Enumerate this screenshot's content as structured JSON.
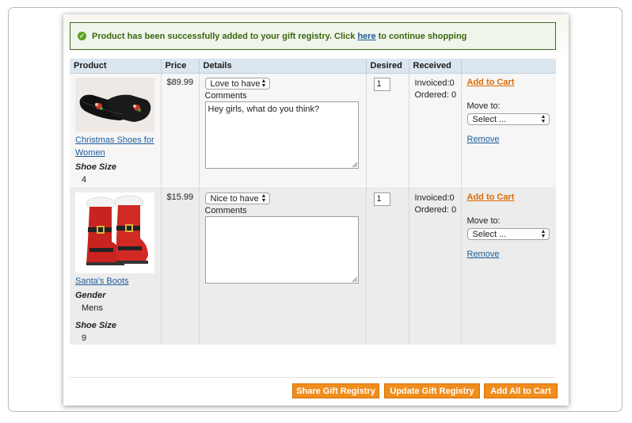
{
  "message": {
    "text_before": "Product has been successfully added to your gift registry. Click",
    "link": "here",
    "text_after": "to continue shopping",
    "icon": "success-check-icon"
  },
  "table": {
    "headers": [
      "Product",
      "Price",
      "Details",
      "Desired",
      "Received",
      ""
    ],
    "items": [
      {
        "name": "Christmas Shoes for Women",
        "name_line1": "Christmas Shoes for",
        "name_line2": "Women",
        "options": [
          {
            "label": "Shoe Size",
            "value": "4"
          }
        ],
        "price": "$89.99",
        "priority": "Love to have",
        "comments_label": "Comments",
        "comments": "Hey girls, what do you think?",
        "desired": "1",
        "invoiced": "Invoiced:0",
        "ordered": "Ordered: 0",
        "add_to_cart": "Add to Cart",
        "move_to_label": "Move to:",
        "move_to_value": "Select ...",
        "remove": "Remove"
      },
      {
        "name": "Santa's Boots",
        "options": [
          {
            "label": "Gender",
            "value": "Mens"
          },
          {
            "label": "Shoe Size",
            "value": "9"
          }
        ],
        "price": "$15.99",
        "priority": "Nice to have",
        "comments_label": "Comments",
        "comments": "",
        "desired": "1",
        "invoiced": "Invoiced:0",
        "ordered": "Ordered: 0",
        "add_to_cart": "Add to Cart",
        "move_to_label": "Move to:",
        "move_to_value": "Select ...",
        "remove": "Remove"
      }
    ]
  },
  "buttons": {
    "share": "Share Gift Registry",
    "update": "Update Gift Registry",
    "add_all": "Add All to Cart"
  },
  "colors": {
    "accent_orange": "#f08d1d",
    "link_blue": "#1e5c9b",
    "success_green": "#3d6611",
    "header_blue": "#dbe6ef"
  }
}
